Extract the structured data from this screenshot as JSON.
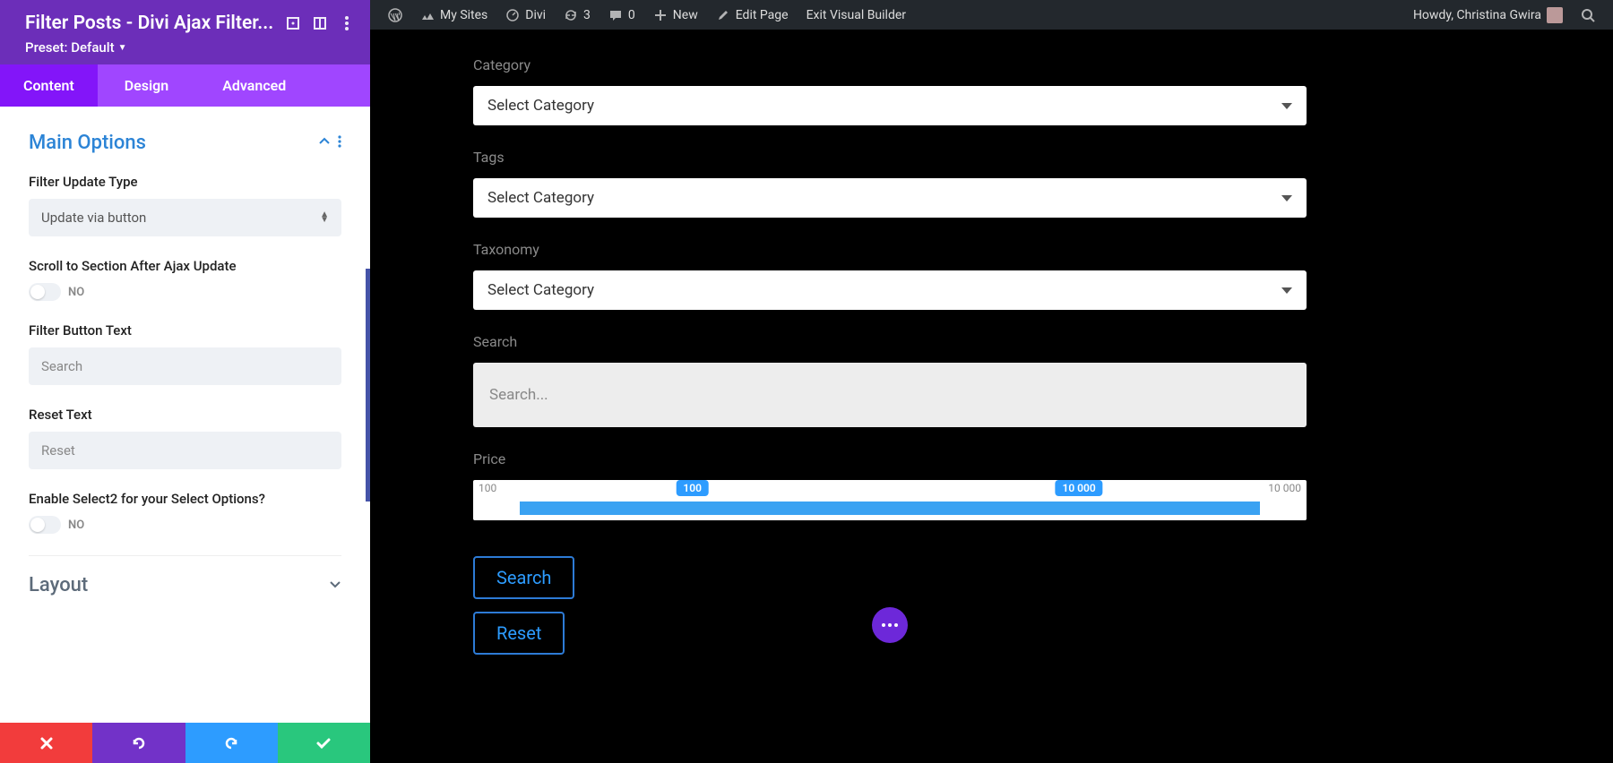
{
  "sidebar": {
    "title": "Filter Posts - Divi Ajax Filter...",
    "preset_label": "Preset: Default",
    "tabs": {
      "content": "Content",
      "design": "Design",
      "advanced": "Advanced"
    },
    "section": {
      "main_options": "Main Options",
      "layout": "Layout"
    },
    "fields": {
      "filter_update_type": {
        "label": "Filter Update Type",
        "value": "Update via button"
      },
      "scroll_after_ajax": {
        "label": "Scroll to Section After Ajax Update",
        "value": "NO"
      },
      "filter_button_text": {
        "label": "Filter Button Text",
        "placeholder": "Search"
      },
      "reset_text": {
        "label": "Reset Text",
        "placeholder": "Reset"
      },
      "enable_select2": {
        "label": "Enable Select2 for your Select Options?",
        "value": "NO"
      }
    }
  },
  "wpbar": {
    "my_sites": "My Sites",
    "site_name": "Divi",
    "updates_count": "3",
    "comments_count": "0",
    "new": "New",
    "edit_page": "Edit Page",
    "exit_vb": "Exit Visual Builder",
    "howdy": "Howdy, Christina Gwira"
  },
  "preview": {
    "category": {
      "label": "Category",
      "value": "Select Category"
    },
    "tags": {
      "label": "Tags",
      "value": "Select Category"
    },
    "taxonomy": {
      "label": "Taxonomy",
      "value": "Select Category"
    },
    "search": {
      "label": "Search",
      "placeholder": "Search..."
    },
    "price": {
      "label": "Price",
      "min": "100",
      "low": "100",
      "high": "10 000",
      "max": "10 000"
    },
    "buttons": {
      "search": "Search",
      "reset": "Reset"
    }
  }
}
